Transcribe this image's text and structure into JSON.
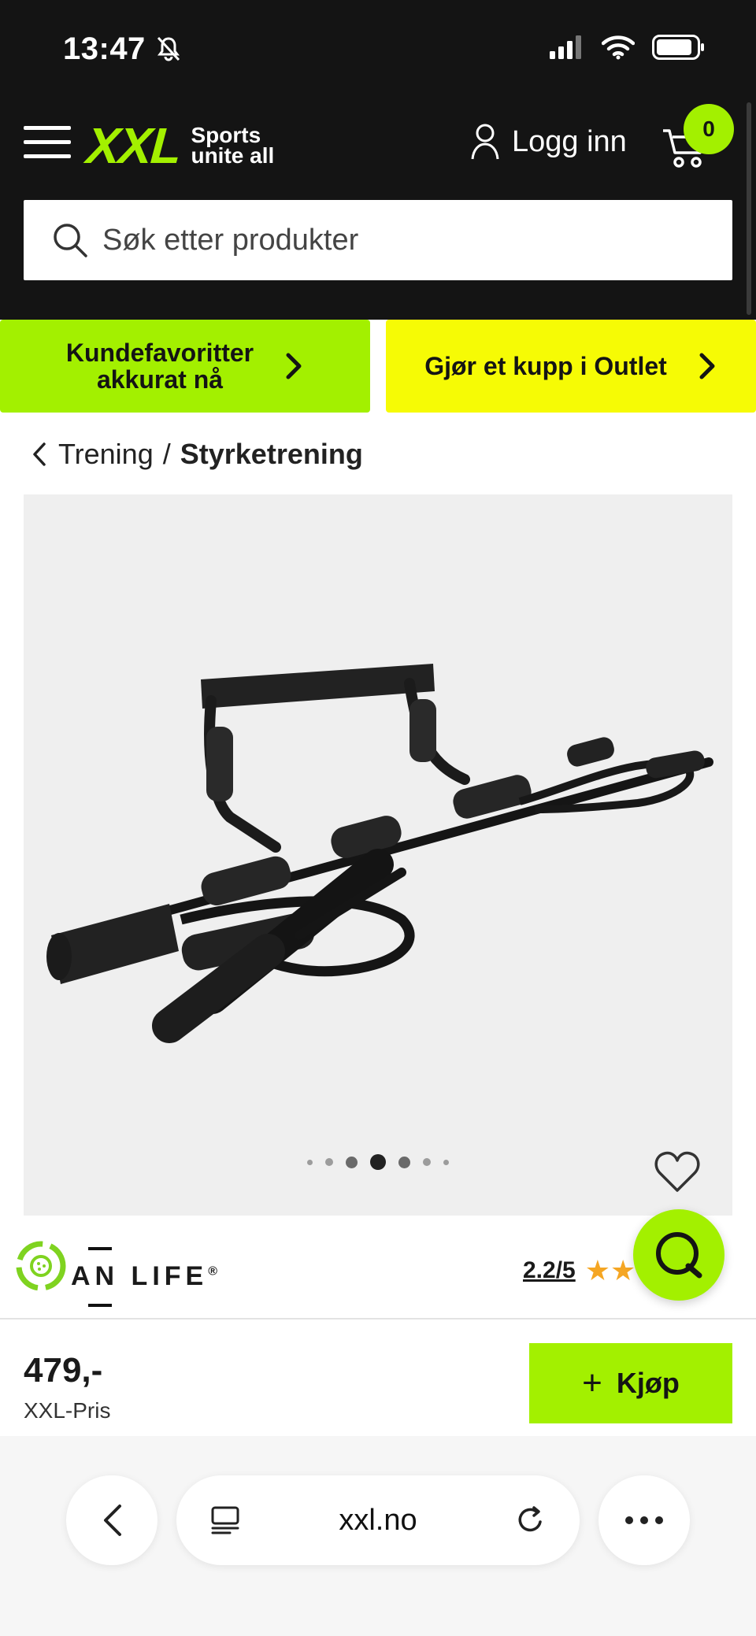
{
  "status_bar": {
    "time": "13:47"
  },
  "header": {
    "logo": "XXL",
    "tagline_line1": "Sports",
    "tagline_line2": "unite all",
    "login_label": "Logg inn",
    "cart_count": "0",
    "search_placeholder": "Søk etter produkter"
  },
  "promos": [
    {
      "line1": "Kundefavoritter",
      "line2": "akkurat nå",
      "color": "#a3f000"
    },
    {
      "line1": "Gjør et kupp i Outlet",
      "line2": "",
      "color": "#f6fb05"
    }
  ],
  "breadcrumb": {
    "parent": "Trening",
    "separator": "/",
    "current": "Styrketrening"
  },
  "product": {
    "image_dots_total": 7,
    "image_dots_active_index": 3,
    "brand_name": "AN LIFE",
    "brand_mark": "®",
    "rating_text": "2.2/5",
    "rating_value": 2.2,
    "rating_max": 5
  },
  "buy_bar": {
    "price": "479,-",
    "price_label": "XXL-Pris",
    "buy_label": "Kjøp"
  },
  "browser": {
    "url": "xxl.no"
  },
  "colors": {
    "accent_green": "#a3f000",
    "accent_yellow": "#f6fb05",
    "header_bg": "#141414",
    "star": "#f5a623"
  }
}
